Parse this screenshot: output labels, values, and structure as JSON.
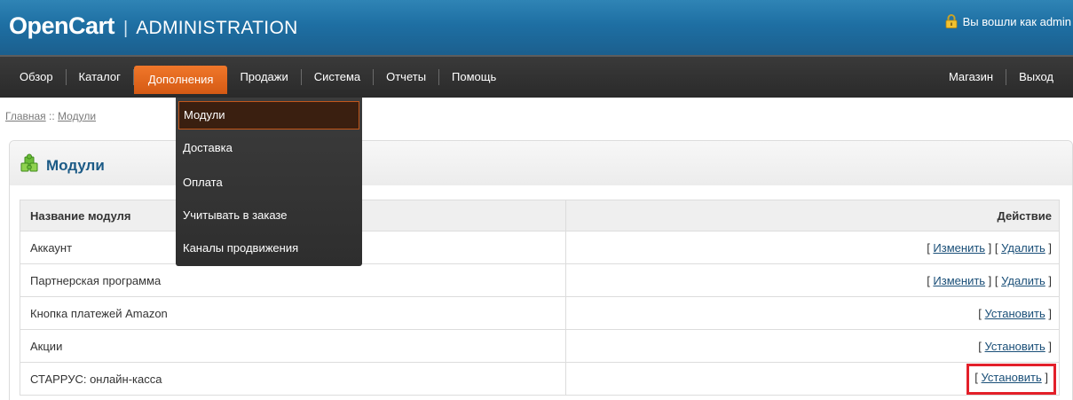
{
  "header": {
    "logo_main": "OpenCart",
    "logo_sep": "|",
    "logo_sub": "ADMINISTRATION",
    "logged_in": "Вы вошли как admin",
    "lock_icon": "lock-icon",
    "bg_color": "#1e6fa3"
  },
  "menu": {
    "left": [
      "Обзор",
      "Каталог",
      "Дополнения",
      "Продажи",
      "Система",
      "Отчеты",
      "Помощь"
    ],
    "right": [
      "Магазин",
      "Выход"
    ],
    "active": "Дополнения",
    "active_color": "#e2661e"
  },
  "dropdown": {
    "items": [
      "Модули",
      "Доставка",
      "Оплата",
      "Учитывать в заказе",
      "Каналы продвижения"
    ],
    "hovered": "Модули"
  },
  "breadcrumb": {
    "home": "Главная",
    "sep": "::",
    "current": "Модули"
  },
  "box": {
    "title": "Модули",
    "icon": "puzzle-icon"
  },
  "table": {
    "col_name": "Название модуля",
    "col_action": "Действие",
    "rows": [
      {
        "name": "Аккаунт",
        "actions": [
          "Изменить",
          "Удалить"
        ]
      },
      {
        "name": "Партнерская программа",
        "actions": [
          "Изменить",
          "Удалить"
        ]
      },
      {
        "name": "Кнопка платежей Amazon",
        "actions": [
          "Установить"
        ]
      },
      {
        "name": "Акции",
        "actions": [
          "Установить"
        ]
      },
      {
        "name": "СТАРРУС: онлайн-касса",
        "actions": [
          "Установить"
        ]
      }
    ],
    "highlight_color": "#e3202a"
  }
}
